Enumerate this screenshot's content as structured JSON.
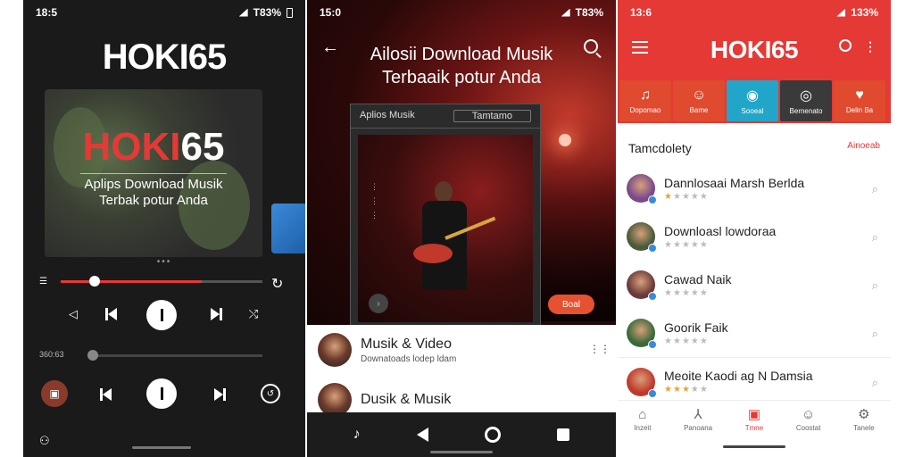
{
  "phone1": {
    "status_time": "18:5",
    "status_right": "T83%",
    "logo": "HOKI65",
    "art_brand_red": "HOKI",
    "art_brand_white": "65",
    "art_subtitle_line1": "Aplips Download Musik",
    "art_subtitle_line2": "Terbak potur Anda",
    "progress": 0.7,
    "progress_color": "#e53935",
    "lower_label": "360:63",
    "lower_progress": 0.1
  },
  "phone2": {
    "status_time": "15:0",
    "status_right": "T83%",
    "title_line1": "Ailosii Download Musik",
    "title_line2": "Terbaaik potur Anda",
    "card_tab1": "Aplios Musik",
    "card_tab2": "Tamtamo",
    "pill_label": "Boal",
    "list": [
      {
        "title": "Musik & Video",
        "subtitle": "Downatoads lodep ldam"
      },
      {
        "title": "Dusik & Musik",
        "subtitle": ""
      }
    ]
  },
  "phone3": {
    "status_time": "13:6",
    "status_right": "133%",
    "logo": "HOKI65",
    "categories": [
      {
        "label": "Dopomao",
        "icon": "music-icon",
        "glyph": "♫",
        "bg": "#e04a2e"
      },
      {
        "label": "Bame",
        "icon": "game-icon",
        "glyph": "☺",
        "bg": "#e04a2e"
      },
      {
        "label": "Sooeal",
        "icon": "eye-icon",
        "glyph": "◉",
        "bg": "#21a6c9"
      },
      {
        "label": "Bernenato",
        "icon": "bulb-icon",
        "glyph": "◎",
        "bg": "#3a3a3a"
      },
      {
        "label": "Delin Ba",
        "icon": "heart-icon",
        "glyph": "♥",
        "bg": "#e04a2e"
      }
    ],
    "section_title": "Tamcdolety",
    "section_more": "Ainoeab",
    "rows": [
      {
        "name": "Dannlosaai Marsh Berlda",
        "rating": 1,
        "avatar": "#7a4a8a"
      },
      {
        "name": "Downloasl lowdoraa",
        "rating": 0,
        "avatar": "#4a5a3a"
      },
      {
        "name": "Cawad Naik",
        "rating": 0,
        "avatar": "#6a3a3a"
      },
      {
        "name": "Goorik Faik",
        "rating": 0,
        "avatar": "#3a6a3a"
      },
      {
        "name": "Meoite Kaodi ag N Damsia",
        "rating": 3,
        "avatar": "#c0392b"
      }
    ],
    "bottom_nav": [
      {
        "label": "Inzeit",
        "icon": "home-icon",
        "glyph": "⌂"
      },
      {
        "label": "Panoana",
        "icon": "explore-icon",
        "glyph": "⅄"
      },
      {
        "label": "Tmne",
        "icon": "library-icon",
        "glyph": "▣",
        "active": true
      },
      {
        "label": "Coostat",
        "icon": "smile-icon",
        "glyph": "☺"
      },
      {
        "label": "Tanele",
        "icon": "settings-icon",
        "glyph": "⚙"
      }
    ]
  }
}
